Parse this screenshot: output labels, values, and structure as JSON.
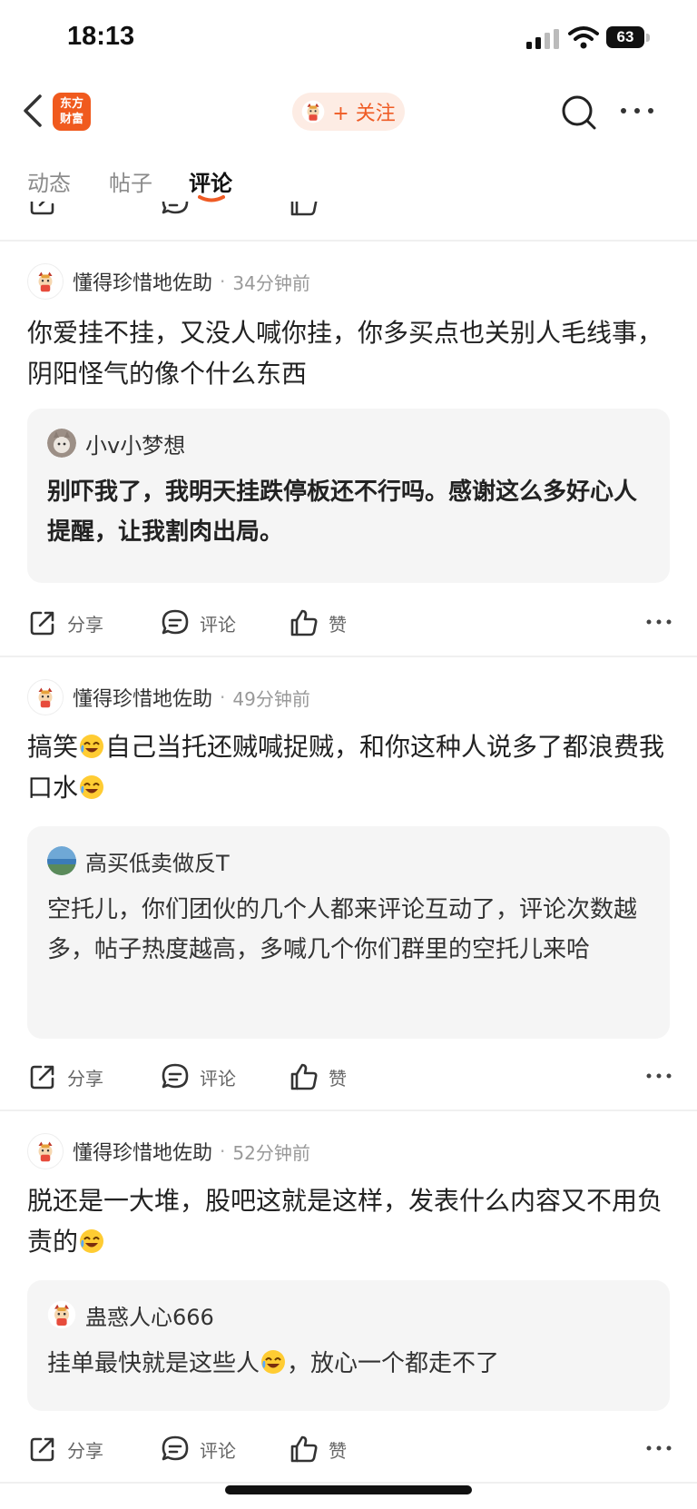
{
  "status_bar": {
    "time": "18:13",
    "battery": "63"
  },
  "header": {
    "logo_line1": "东方",
    "logo_line2": "财富",
    "follow_label": "+ 关注"
  },
  "tabs": [
    {
      "label": "动态"
    },
    {
      "label": "帖子"
    },
    {
      "label": "评论",
      "active": true
    }
  ],
  "actions": {
    "share": "分享",
    "comment": "评论",
    "like": "赞"
  },
  "comments": [
    {
      "author": "懂得珍惜地佐助",
      "time_ago": "34分钟前",
      "text": "你爱挂不挂，又没人喊你挂，你多买点也关别人毛线事，阴阳怪气的像个什么东西",
      "quote": {
        "author": "小v小梦想",
        "text": "别吓我了，我明天挂跌停板还不行吗。感谢这么多好心人提醒，让我割肉出局。"
      }
    },
    {
      "author": "懂得珍惜地佐助",
      "time_ago": "49分钟前",
      "text_a": "搞笑",
      "text_b": "自己当托还贼喊捉贼，和你这种人说多了都浪费我口水",
      "quote": {
        "author": "高买低卖做反T",
        "text": "空托儿，你们团伙的几个人都来评论互动了，评论次数越多，帖子热度越高，多喊几个你们群里的空托儿来哈"
      }
    },
    {
      "author": "懂得珍惜地佐助",
      "time_ago": "52分钟前",
      "text": "脱还是一大堆，股吧这就是这样，发表什么内容又不用负责的",
      "quote": {
        "author": "蛊惑人心666",
        "text_a": "挂单最快就是这些人",
        "text_b": "，放心一个都走不了"
      }
    }
  ],
  "colors": {
    "accent": "#ef5b24",
    "quote_bg": "#f5f5f5"
  }
}
